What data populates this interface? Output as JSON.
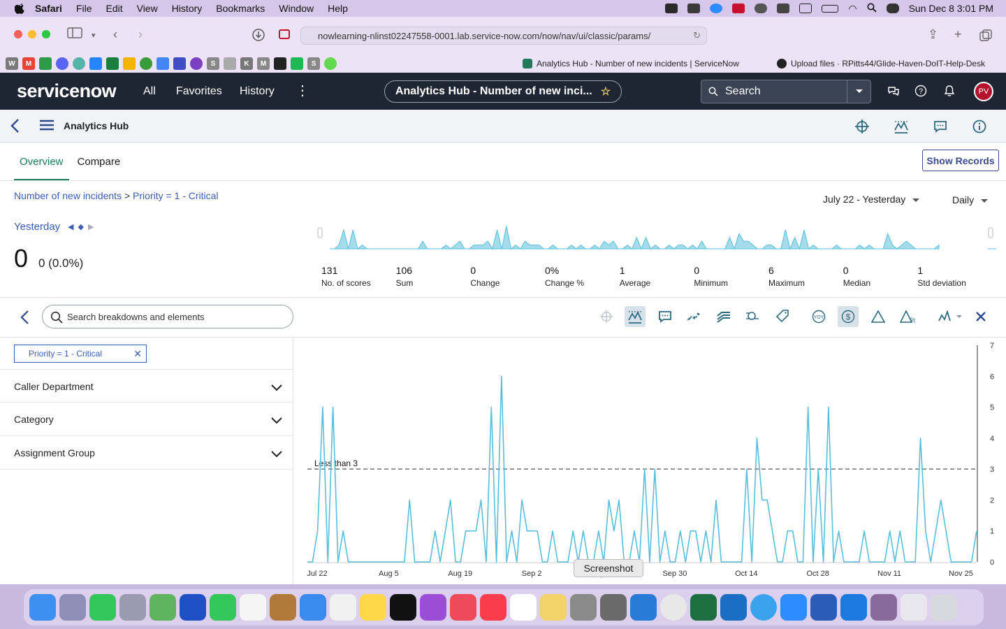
{
  "menubar": {
    "app": "Safari",
    "items": [
      "File",
      "Edit",
      "View",
      "History",
      "Bookmarks",
      "Window",
      "Help"
    ],
    "clock": "Sun Dec 8  3:01 PM"
  },
  "browser": {
    "url": "nowlearning-nlinst02247558-0001.lab.service-now.com/now/nav/ui/classic/params/",
    "tabs": [
      {
        "label": "Analytics Hub - Number of new incidents | ServiceNow"
      },
      {
        "label": "Upload files · RPitts44/Glide-Haven-DoIT-Help-Desk"
      }
    ]
  },
  "snheader": {
    "logo": "servicenow",
    "nav": [
      "All",
      "Favorites",
      "History"
    ],
    "title": "Analytics Hub - Number of new inci...",
    "search_label": "Search",
    "avatar": "PV"
  },
  "subheader": {
    "title": "Analytics Hub"
  },
  "tabs": {
    "overview": "Overview",
    "compare": "Compare"
  },
  "show_records": "Show Records",
  "breadcrumb": {
    "first": "Number of new incidents",
    "sep": ">",
    "second": "Priority = 1 - Critical"
  },
  "period": {
    "range": "July 22 - Yesterday",
    "frequency": "Daily"
  },
  "summary": {
    "label": "Yesterday",
    "value": "0",
    "change": "0 (0.0%)"
  },
  "stats": [
    {
      "value": "131",
      "label": "No. of scores"
    },
    {
      "value": "106",
      "label": "Sum"
    },
    {
      "value": "0",
      "label": "Change"
    },
    {
      "value": "0%",
      "label": "Change %"
    },
    {
      "value": "1",
      "label": "Average"
    },
    {
      "value": "0",
      "label": "Minimum"
    },
    {
      "value": "6",
      "label": "Maximum"
    },
    {
      "value": "0",
      "label": "Median"
    },
    {
      "value": "1",
      "label": "Std deviation"
    }
  ],
  "breakdown_search": {
    "placeholder": "Search breakdowns and elements"
  },
  "filter_chip": "Priority = 1 - Critical",
  "breakdowns": [
    "Caller Department",
    "Category",
    "Assignment Group"
  ],
  "tooltip": "Screenshot",
  "colors": {
    "series": "#57bfdc",
    "accent": "#1e7a5a",
    "link": "#3c5eb3",
    "navbar": "#1f2633"
  },
  "chart_data": {
    "type": "line",
    "ylim": [
      0,
      7
    ],
    "yticks": [
      0,
      1,
      2,
      3,
      4,
      5,
      6,
      7
    ],
    "xtick_labels": [
      "Jul 22",
      "Aug 5",
      "Aug 19",
      "Sep 2",
      "Sep 16",
      "Sep 30",
      "Oct 14",
      "Oct 28",
      "Nov 11",
      "Nov 25"
    ],
    "threshold": {
      "value": 3,
      "label": "Less than 3"
    },
    "start_date": "Jul 22",
    "interval": "daily",
    "series": [
      {
        "values": [
          0,
          0,
          1,
          5,
          0,
          5,
          0,
          1,
          0,
          0,
          0,
          0,
          0,
          0,
          0,
          0,
          0,
          0,
          0,
          0,
          2,
          0,
          0,
          0,
          0,
          1,
          0,
          1,
          2,
          0,
          0,
          1,
          1,
          1,
          2,
          0,
          5,
          0,
          6,
          0,
          1,
          0,
          2,
          1,
          1,
          1,
          0,
          0,
          1,
          0,
          0,
          0,
          1,
          0,
          1,
          0,
          0,
          1,
          0,
          2,
          1,
          2,
          0,
          0,
          1,
          0,
          3,
          0,
          3,
          0,
          1,
          0,
          0,
          1,
          0,
          1,
          1,
          0,
          1,
          0,
          2,
          0,
          0,
          0,
          0,
          0,
          3,
          0,
          4,
          2,
          2,
          1,
          0,
          0,
          1,
          1,
          0,
          0,
          5,
          0,
          3,
          0,
          5,
          0,
          1,
          0,
          0,
          0,
          0,
          1,
          0,
          0,
          0,
          0,
          1,
          0,
          1,
          0,
          0,
          0,
          4,
          1,
          0,
          1,
          2,
          1,
          0,
          0,
          0,
          0,
          0,
          1
        ]
      }
    ]
  }
}
